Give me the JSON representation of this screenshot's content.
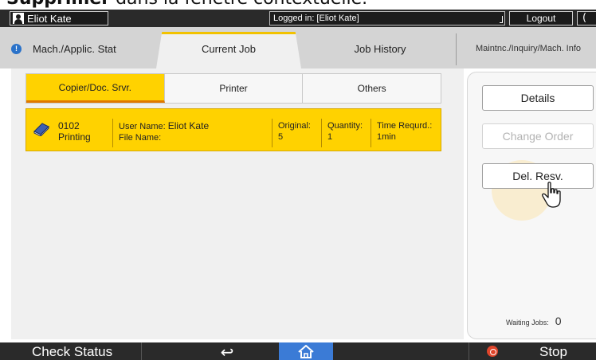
{
  "caption": {
    "bold": "Supprimer",
    "text": " dans la fenêtre contextuelle."
  },
  "topbar": {
    "user_name": "Eliot Kate",
    "logged_in": "Logged in: [Eliot Kate]",
    "logout_label": "Logout",
    "moon_glyph": "("
  },
  "tabs": [
    {
      "label": "Mach./Applic. Stat"
    },
    {
      "label": "Current Job"
    },
    {
      "label": "Job History"
    },
    {
      "label": "Maintnc./Inquiry/Mach. Info"
    }
  ],
  "subtabs": [
    {
      "label": "Copier/Doc. Srvr."
    },
    {
      "label": "Printer"
    },
    {
      "label": "Others"
    }
  ],
  "job": {
    "id": "0102",
    "status": "Printing",
    "user_name_label": "User Name:",
    "user_name_value": "Eliot Kate",
    "file_name_label": "File Name:",
    "original_label": "Original:",
    "original_value": "5",
    "quantity_label": "Quantity:",
    "quantity_value": "1",
    "time_label": "Time Requrd.:",
    "time_value": "1min"
  },
  "side": {
    "details_label": "Details",
    "change_order_label": "Change Order",
    "del_resv_label": "Del. Resv.",
    "waiting_label": "Waiting Jobs:",
    "waiting_count": "0"
  },
  "bottom": {
    "check_status_label": "Check Status",
    "back_glyph": "↩",
    "stop_label": "Stop"
  },
  "colors": {
    "accent_yellow": "#ffd200",
    "active_underline": "#e07800",
    "home_blue": "#3b7bd6",
    "stop_red": "#e0452b",
    "info_blue": "#2a72c9"
  },
  "icons": [
    "user-icon",
    "info-icon",
    "book-icon",
    "pointer-hand-icon",
    "back-icon",
    "home-icon",
    "stop-icon"
  ]
}
